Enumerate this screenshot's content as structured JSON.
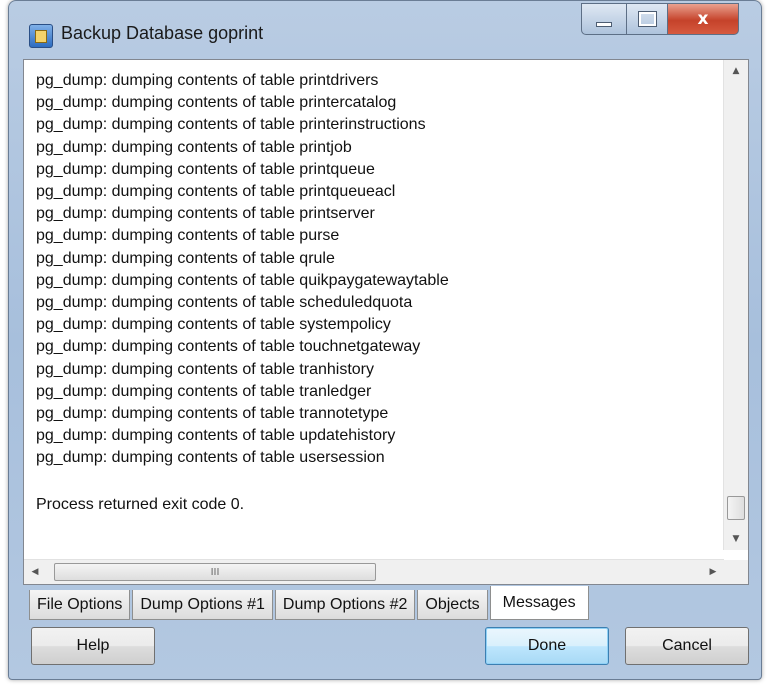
{
  "window": {
    "title": "Backup Database goprint",
    "close_glyph": "x"
  },
  "log": {
    "lines": [
      "pg_dump: dumping contents of table printdrivers",
      "pg_dump: dumping contents of table printercatalog",
      "pg_dump: dumping contents of table printerinstructions",
      "pg_dump: dumping contents of table printjob",
      "pg_dump: dumping contents of table printqueue",
      "pg_dump: dumping contents of table printqueueacl",
      "pg_dump: dumping contents of table printserver",
      "pg_dump: dumping contents of table purse",
      "pg_dump: dumping contents of table qrule",
      "pg_dump: dumping contents of table quikpaygatewaytable",
      "pg_dump: dumping contents of table scheduledquota",
      "pg_dump: dumping contents of table systempolicy",
      "pg_dump: dumping contents of table touchnetgateway",
      "pg_dump: dumping contents of table tranhistory",
      "pg_dump: dumping contents of table tranledger",
      "pg_dump: dumping contents of table trannotetype",
      "pg_dump: dumping contents of table updatehistory",
      "pg_dump: dumping contents of table usersession"
    ],
    "exit_message": "Process returned exit code 0."
  },
  "scrollbar": {
    "grip_glyph": "III"
  },
  "tabs": [
    {
      "label": "File Options",
      "active": false
    },
    {
      "label": "Dump Options #1",
      "active": false
    },
    {
      "label": "Dump Options #2",
      "active": false
    },
    {
      "label": "Objects",
      "active": false
    },
    {
      "label": "Messages",
      "active": true
    }
  ],
  "buttons": {
    "help": "Help",
    "done": "Done",
    "cancel": "Cancel"
  },
  "icons": {
    "app": "database-backup-icon",
    "minimize": "minimize-icon",
    "maximize": "maximize-icon",
    "close": "close-icon"
  }
}
